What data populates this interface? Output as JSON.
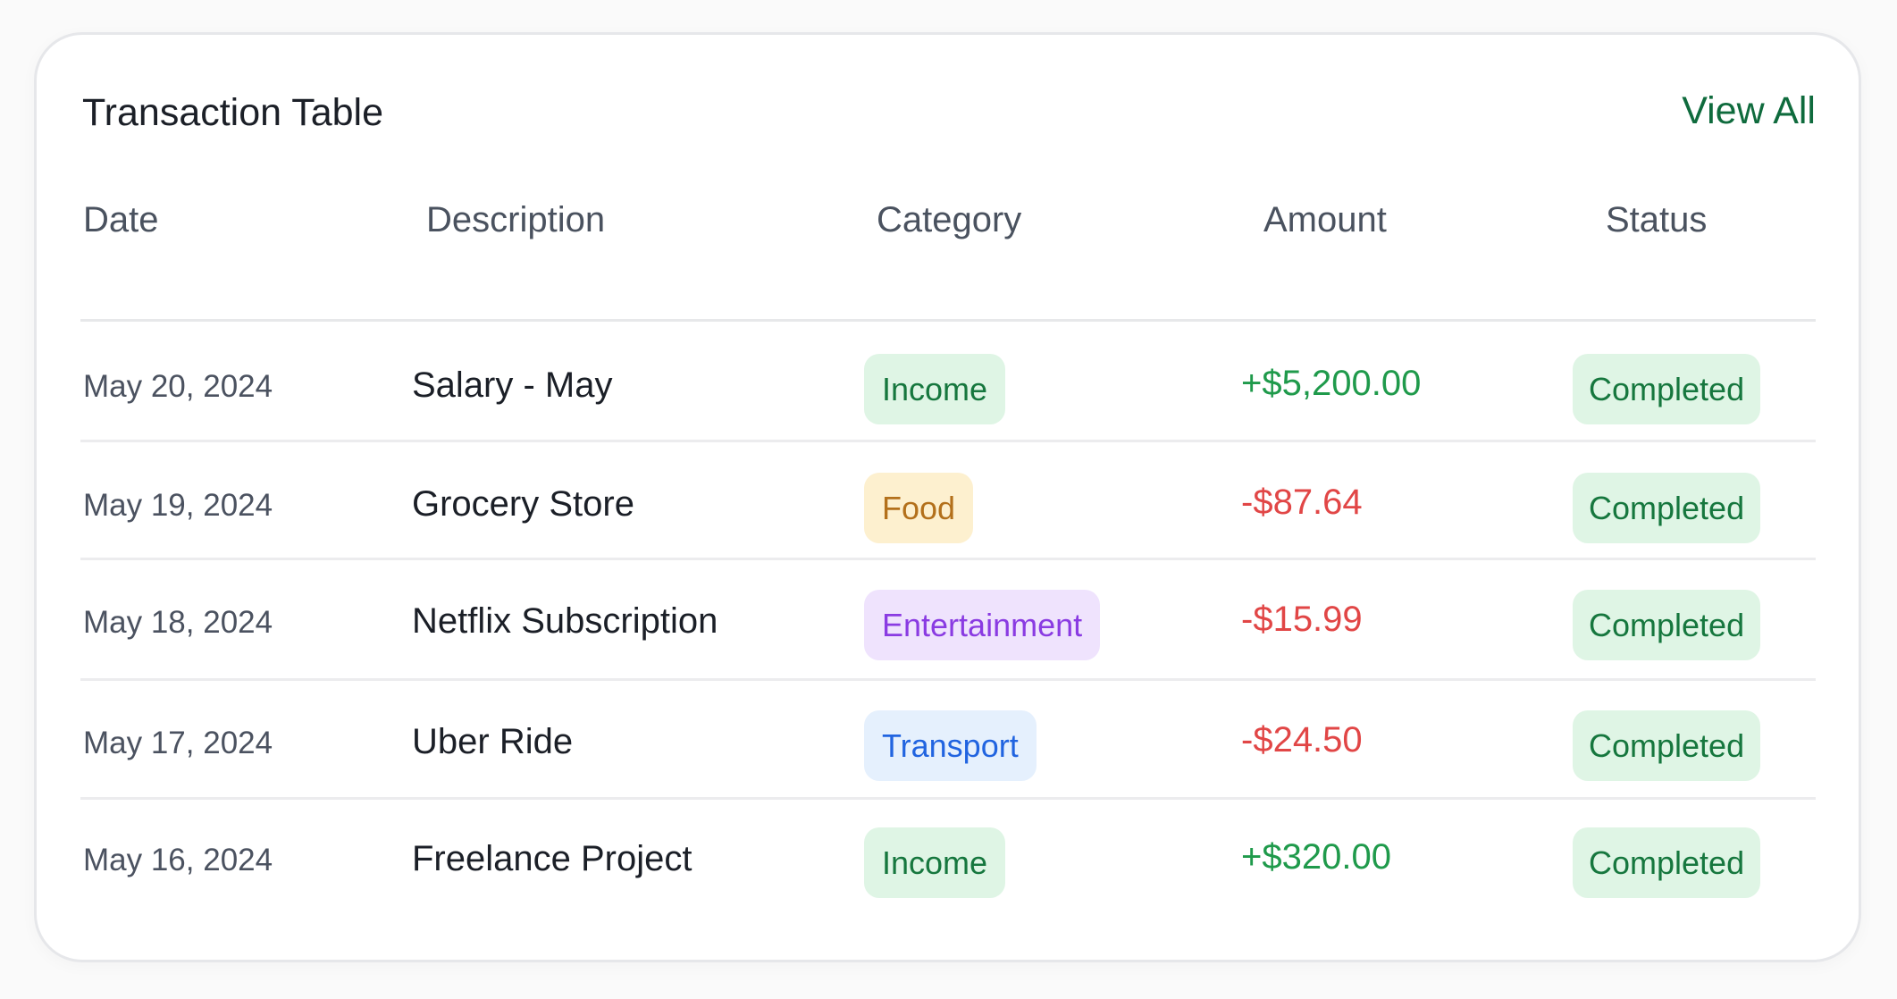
{
  "card": {
    "title": "Transaction Table",
    "view_all": "View All"
  },
  "columns": [
    "Date",
    "Description",
    "Category",
    "Amount",
    "Status"
  ],
  "rows": [
    {
      "date": "May 20, 2024",
      "description": "Salary - May",
      "category": "Income",
      "category_style": "income",
      "amount": "+$5,200.00",
      "amount_type": "positive",
      "status": "Completed"
    },
    {
      "date": "May 19, 2024",
      "description": "Grocery Store",
      "category": "Food",
      "category_style": "food",
      "amount": "-$87.64",
      "amount_type": "negative",
      "status": "Completed"
    },
    {
      "date": "May 18, 2024",
      "description": "Netflix Subscription",
      "category": "Entertainment",
      "category_style": "entertainment",
      "amount": "-$15.99",
      "amount_type": "negative",
      "status": "Completed"
    },
    {
      "date": "May 17, 2024",
      "description": "Uber Ride",
      "category": "Transport",
      "category_style": "transport",
      "amount": "-$24.50",
      "amount_type": "negative",
      "status": "Completed"
    },
    {
      "date": "May 16, 2024",
      "description": "Freelance Project",
      "category": "Income",
      "category_style": "income",
      "amount": "+$320.00",
      "amount_type": "positive",
      "status": "Completed"
    }
  ],
  "colors": {
    "positive": "#1f9a4b",
    "negative": "#e14646",
    "income_bg": "#dff5e5",
    "income_fg": "#16773e",
    "food_bg": "#fdf0cf",
    "food_fg": "#b3701b",
    "entertainment_bg": "#efe3fd",
    "entertainment_fg": "#8a3be2",
    "transport_bg": "#e5f0fd",
    "transport_fg": "#2164e0",
    "status_bg": "#dff5e5",
    "status_fg": "#16773e"
  }
}
